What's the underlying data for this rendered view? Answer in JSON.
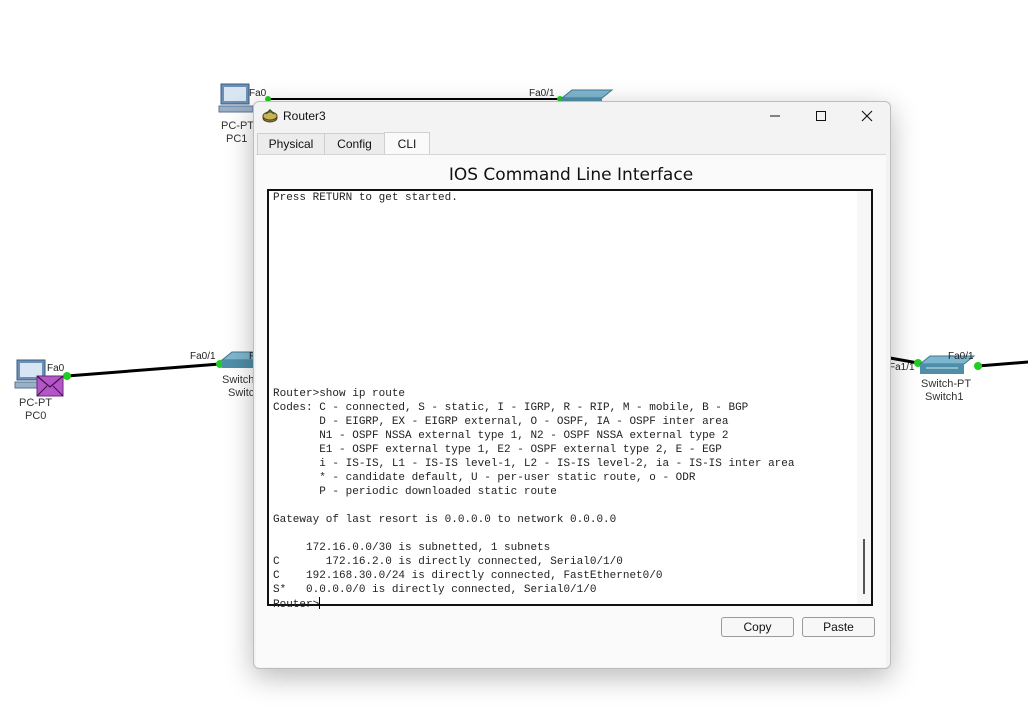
{
  "topology": {
    "devices": [
      {
        "id": "pc1",
        "type_label": "PC-PT",
        "name": "PC1"
      },
      {
        "id": "pc0",
        "type_label": "PC-PT",
        "name": "PC0"
      },
      {
        "id": "switch0",
        "type_label": "Switch",
        "name": "Switc"
      },
      {
        "id": "switch1",
        "type_label": "Switch-PT",
        "name": "Switch1"
      }
    ],
    "ports": {
      "pc1_fa0": "Fa0",
      "top_switch_fa01": "Fa0/1",
      "pc0_fa0": "Fa0",
      "switch0_fa01": "Fa0/1",
      "switch0_partial": "F",
      "switch1_fa11": "Fa1/1",
      "switch1_fa01": "Fa0/1"
    },
    "link_status_color": "#22cc22",
    "pdu_color": "#b455c9"
  },
  "window": {
    "title": "Router3",
    "icons": {
      "app": "router-icon",
      "minimize": "minimize-icon",
      "maximize": "maximize-icon",
      "close": "close-icon"
    }
  },
  "tabs": [
    {
      "label": "Physical",
      "active": false
    },
    {
      "label": "Config",
      "active": false
    },
    {
      "label": "CLI",
      "active": true
    }
  ],
  "cli": {
    "heading": "IOS Command Line Interface",
    "lines": [
      "Press RETURN to get started.",
      "",
      "",
      "",
      "",
      "",
      "",
      "",
      "",
      "",
      "",
      "",
      "",
      "",
      "Router>show ip route",
      "Codes: C - connected, S - static, I - IGRP, R - RIP, M - mobile, B - BGP",
      "       D - EIGRP, EX - EIGRP external, O - OSPF, IA - OSPF inter area",
      "       N1 - OSPF NSSA external type 1, N2 - OSPF NSSA external type 2",
      "       E1 - OSPF external type 1, E2 - OSPF external type 2, E - EGP",
      "       i - IS-IS, L1 - IS-IS level-1, L2 - IS-IS level-2, ia - IS-IS inter area",
      "       * - candidate default, U - per-user static route, o - ODR",
      "       P - periodic downloaded static route",
      "",
      "Gateway of last resort is 0.0.0.0 to network 0.0.0.0",
      "",
      "     172.16.0.0/30 is subnetted, 1 subnets",
      "C       172.16.2.0 is directly connected, Serial0/1/0",
      "C    192.168.30.0/24 is directly connected, FastEthernet0/0",
      "S*   0.0.0.0/0 is directly connected, Serial0/1/0"
    ],
    "prompt": "Router>"
  },
  "buttons": {
    "copy": "Copy",
    "paste": "Paste"
  }
}
